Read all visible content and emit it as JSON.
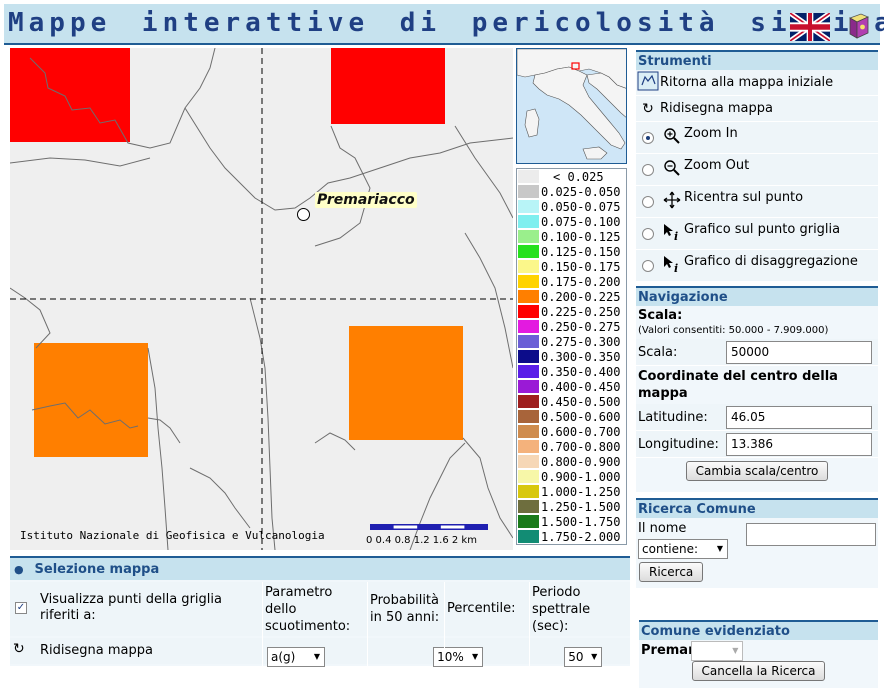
{
  "header": {
    "title": "Mappe interattive di pericolosità sismica",
    "flag_icon": "uk-flag-icon",
    "help_icon": "help-book-icon"
  },
  "map": {
    "credit": "Istituto Nazionale di Geofisica e Vulcanologia",
    "city_label": "Premariacco",
    "scale_ticks": "0 0.4 0.8 1.2 1.6 2 km",
    "colors": {
      "red": "#ff0000",
      "orange": "#ff7f00",
      "background": "#efefef"
    }
  },
  "legend": [
    {
      "label": "< 0.025",
      "color": "#ececec"
    },
    {
      "label": "0.025-0.050",
      "color": "#c8c8c8"
    },
    {
      "label": "0.050-0.075",
      "color": "#b8f4f7"
    },
    {
      "label": "0.075-0.100",
      "color": "#7fefef"
    },
    {
      "label": "0.100-0.125",
      "color": "#9aef8c"
    },
    {
      "label": "0.125-0.150",
      "color": "#26e11e"
    },
    {
      "label": "0.150-0.175",
      "color": "#fbf78a"
    },
    {
      "label": "0.175-0.200",
      "color": "#ffd300"
    },
    {
      "label": "0.200-0.225",
      "color": "#ff7f00"
    },
    {
      "label": "0.225-0.250",
      "color": "#ff0000"
    },
    {
      "label": "0.250-0.275",
      "color": "#e31ae0"
    },
    {
      "label": "0.275-0.300",
      "color": "#6b5fd6"
    },
    {
      "label": "0.300-0.350",
      "color": "#0c0c8a"
    },
    {
      "label": "0.350-0.400",
      "color": "#5a1ee8"
    },
    {
      "label": "0.400-0.450",
      "color": "#9a1ad6"
    },
    {
      "label": "0.450-0.500",
      "color": "#9e1e1e"
    },
    {
      "label": "0.500-0.600",
      "color": "#a8643a"
    },
    {
      "label": "0.600-0.700",
      "color": "#cf8c4e"
    },
    {
      "label": "0.700-0.800",
      "color": "#f4b27c"
    },
    {
      "label": "0.800-0.900",
      "color": "#f6d7b6"
    },
    {
      "label": "0.900-1.000",
      "color": "#f7f7a8"
    },
    {
      "label": "1.000-1.250",
      "color": "#d8c80e"
    },
    {
      "label": "1.250-1.500",
      "color": "#6e6e3e"
    },
    {
      "label": "1.500-1.750",
      "color": "#1a7a1a"
    },
    {
      "label": "1.750-2.000",
      "color": "#128c74"
    }
  ],
  "tools": {
    "title": "Strumenti",
    "reset": "Ritorna alla mappa iniziale",
    "redraw": "Ridisegna mappa",
    "options": [
      {
        "label": "Zoom In",
        "icon": "zoom-in-icon",
        "checked": true
      },
      {
        "label": "Zoom Out",
        "icon": "zoom-out-icon",
        "checked": false
      },
      {
        "label": "Ricentra sul punto",
        "icon": "pan-arrows-icon",
        "checked": false
      },
      {
        "label": "Grafico sul punto griglia",
        "icon": "info-cursor-icon",
        "checked": false
      },
      {
        "label": "Grafico di disaggregazione",
        "icon": "info-cursor-icon",
        "checked": false
      }
    ]
  },
  "navigation": {
    "title": "Navigazione",
    "scale_heading": "Scala:",
    "scale_note": "(Valori consentiti: 50.000 - 7.909.000)",
    "scale_label": "Scala:",
    "scale_value": "50000",
    "coords_heading": "Coordinate del centro della mappa",
    "lat_label": "Latitudine:",
    "lat_value": "46.05",
    "lon_label": "Longitudine:",
    "lon_value": "13.386",
    "apply_button": "Cambia scala/centro"
  },
  "search": {
    "title": "Ricerca Comune",
    "name_label": "Il nome",
    "match_option": "contiene:",
    "query_value": "",
    "button": "Ricerca"
  },
  "highlight": {
    "title": "Comune evidenziato",
    "name": "Premariacco",
    "button": "Cancella la Ricerca"
  },
  "selection": {
    "title": "Selezione mappa",
    "show_grid_label": "Visualizza punti della griglia riferiti a:",
    "show_grid_checked": true,
    "redraw": "Ridisegna mappa",
    "col_param": "Parametro dello scuotimento:",
    "col_prob": "Probabilità in 50 anni:",
    "col_pct": "Percentile:",
    "col_period": "Periodo spettrale (sec):",
    "param_value": "a(g)",
    "prob_value": "10%",
    "pct_value": "50",
    "period_value": ""
  }
}
